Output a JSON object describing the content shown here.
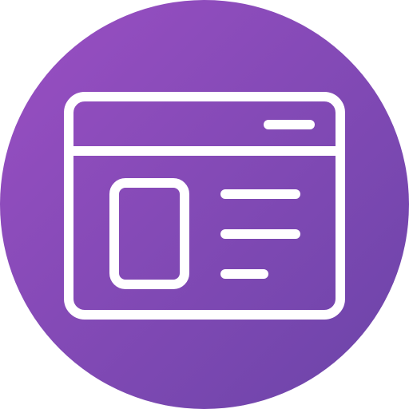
{
  "icon": {
    "name": "browser-window-article-icon",
    "style": "line icon on circular badge",
    "colors": {
      "gradient_start": "#9a4fc3",
      "gradient_end": "#6b44a8",
      "stroke": "#ffffff"
    }
  }
}
